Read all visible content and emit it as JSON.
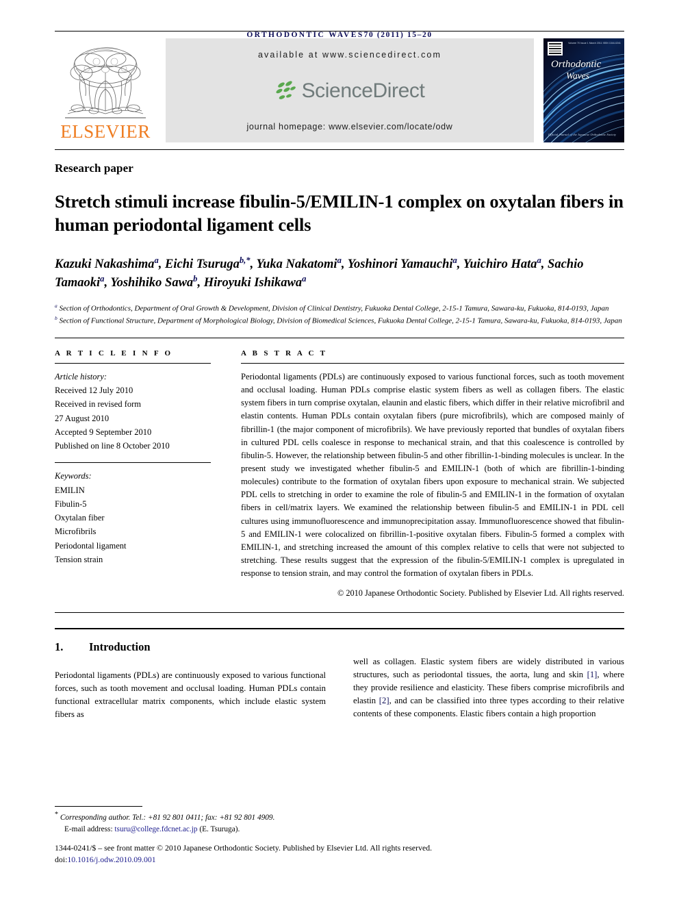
{
  "running_head": {
    "journal": "ORTHODONTIC WAVES",
    "citation": "70 (2011) 15–20"
  },
  "masthead": {
    "publisher": "ELSEVIER",
    "available_at": "available at www.sciencedirect.com",
    "sciencedirect_wordmark": "ScienceDirect",
    "journal_homepage": "journal homepage: www.elsevier.com/locate/odw",
    "cover": {
      "title_line1": "Orthodontic",
      "title_line2": "Waves",
      "top_line": "Volume 70 Issue 1  March 2011  ISSN 1344-0241",
      "foot_line": "Official Journal of the Japanese Orthodontic Society"
    }
  },
  "article": {
    "type": "Research paper",
    "title": "Stretch stimuli increase fibulin-5/EMILIN-1 complex on oxytalan fibers in human periodontal ligament cells",
    "authors": [
      {
        "name": "Kazuki Nakashima",
        "marks": "a",
        "sep": ", "
      },
      {
        "name": "Eichi Tsuruga",
        "marks": "b,*",
        "sep": ", "
      },
      {
        "name": "Yuka Nakatomi",
        "marks": "a",
        "sep": ", "
      },
      {
        "name": "Yoshinori Yamauchi",
        "marks": "a",
        "sep": ", "
      },
      {
        "name": "Yuichiro Hata",
        "marks": "a",
        "sep": ", "
      },
      {
        "name": "Sachio Tamaoki",
        "marks": "a",
        "sep": ", "
      },
      {
        "name": "Yoshihiko Sawa",
        "marks": "b",
        "sep": ", "
      },
      {
        "name": "Hiroyuki Ishikawa",
        "marks": "a",
        "sep": ""
      }
    ],
    "affiliations": [
      {
        "mark": "a",
        "text": "Section of Orthodontics, Department of Oral Growth & Development, Division of Clinical Dentistry, Fukuoka Dental College, 2-15-1 Tamura, Sawara-ku, Fukuoka, 814-0193, Japan"
      },
      {
        "mark": "b",
        "text": "Section of Functional Structure, Department of Morphological Biology, Division of Biomedical Sciences, Fukuoka Dental College, 2-15-1 Tamura, Sawara-ku, Fukuoka, 814-0193, Japan"
      }
    ]
  },
  "article_info": {
    "heading": "A R T I C L E   I N F O",
    "history_label": "Article history:",
    "history": [
      "Received 12 July 2010",
      "Received in revised form",
      "27 August 2010",
      "Accepted 9 September 2010",
      "Published on line 8 October 2010"
    ],
    "keywords_label": "Keywords:",
    "keywords": [
      "EMILIN",
      "Fibulin-5",
      "Oxytalan fiber",
      "Microfibrils",
      "Periodontal ligament",
      "Tension strain"
    ]
  },
  "abstract": {
    "heading": "A B S T R A C T",
    "text": "Periodontal ligaments (PDLs) are continuously exposed to various functional forces, such as tooth movement and occlusal loading. Human PDLs comprise elastic system fibers as well as collagen fibers. The elastic system fibers in turn comprise oxytalan, elaunin and elastic fibers, which differ in their relative microfibril and elastin contents. Human PDLs contain oxytalan fibers (pure microfibrils), which are composed mainly of fibrillin-1 (the major component of microfibrils). We have previously reported that bundles of oxytalan fibers in cultured PDL cells coalesce in response to mechanical strain, and that this coalescence is controlled by fibulin-5. However, the relationship between fibulin-5 and other fibrillin-1-binding molecules is unclear. In the present study we investigated whether fibulin-5 and EMILIN-1 (both of which are fibrillin-1-binding molecules) contribute to the formation of oxytalan fibers upon exposure to mechanical strain. We subjected PDL cells to stretching in order to examine the role of fibulin-5 and EMILIN-1 in the formation of oxytalan fibers in cell/matrix layers. We examined the relationship between fibulin-5 and EMILIN-1 in PDL cell cultures using immunofluorescence and immunoprecipitation assay. Immunofluorescence showed that fibulin-5 and EMILIN-1 were colocalized on fibrillin-1-positive oxytalan fibers. Fibulin-5 formed a complex with EMILIN-1, and stretching increased the amount of this complex relative to cells that were not subjected to stretching. These results suggest that the expression of the fibulin-5/EMILIN-1 complex is upregulated in response to tension strain, and may control the formation of oxytalan fibers in PDLs.",
    "copyright": "© 2010 Japanese Orthodontic Society. Published by Elsevier Ltd. All rights reserved."
  },
  "introduction": {
    "number": "1.",
    "heading": "Introduction",
    "left_text": "Periodontal ligaments (PDLs) are continuously exposed to various functional forces, such as tooth movement and occlusal loading. Human PDLs contain functional extracellular matrix components, which include elastic system fibers as",
    "right_parts": [
      {
        "t": "well as collagen. Elastic system fibers are widely distributed in various structures, such as periodontal tissues, the aorta, lung and skin ",
        "cite": false
      },
      {
        "t": "[1]",
        "cite": true
      },
      {
        "t": ", where they provide resilience and elasticity. These fibers comprise microfibrils and elastin ",
        "cite": false
      },
      {
        "t": "[2]",
        "cite": true
      },
      {
        "t": ", and can be classified into three types according to their relative contents of these components. Elastic fibers contain a high proportion",
        "cite": false
      }
    ]
  },
  "footer": {
    "corresponding_label": "Corresponding author.",
    "corresponding_contact": " Tel.: +81 92 801 0411; fax: +81 92 801 4909.",
    "email_label": "E-mail address:",
    "email": "tsuru@college.fdcnet.ac.jp",
    "email_suffix": " (E. Tsuruga).",
    "issn_line": "1344-0241/$ – see front matter © 2010 Japanese Orthodontic Society. Published by Elsevier Ltd. All rights reserved.",
    "doi_label": "doi:",
    "doi": "10.1016/j.odw.2010.09.001"
  },
  "colors": {
    "elsevier_orange": "#ef7d22",
    "link_blue": "#1a1a8c",
    "running_head_navy": "#0d0d57",
    "sciencedirect_gray": "#707b7b",
    "sciencedirect_green": "#5aa84f",
    "banner_gray": "#e3e3e3"
  }
}
